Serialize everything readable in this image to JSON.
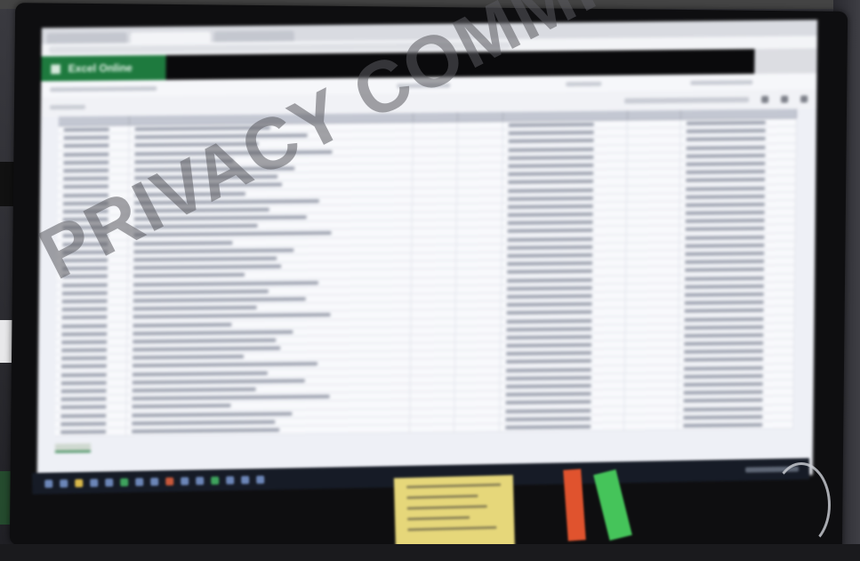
{
  "watermark": {
    "text": "PRIVACY COMMISSION"
  },
  "screen": {
    "app_label": "Excel Online",
    "accent_color": "#1e7a3e",
    "header_bar_color": "#0a0a0c"
  },
  "notes": {
    "red_tag_color": "#e0532e",
    "green_tag_color": "#45c45a",
    "sticky_note_color": "#e6d77a"
  }
}
